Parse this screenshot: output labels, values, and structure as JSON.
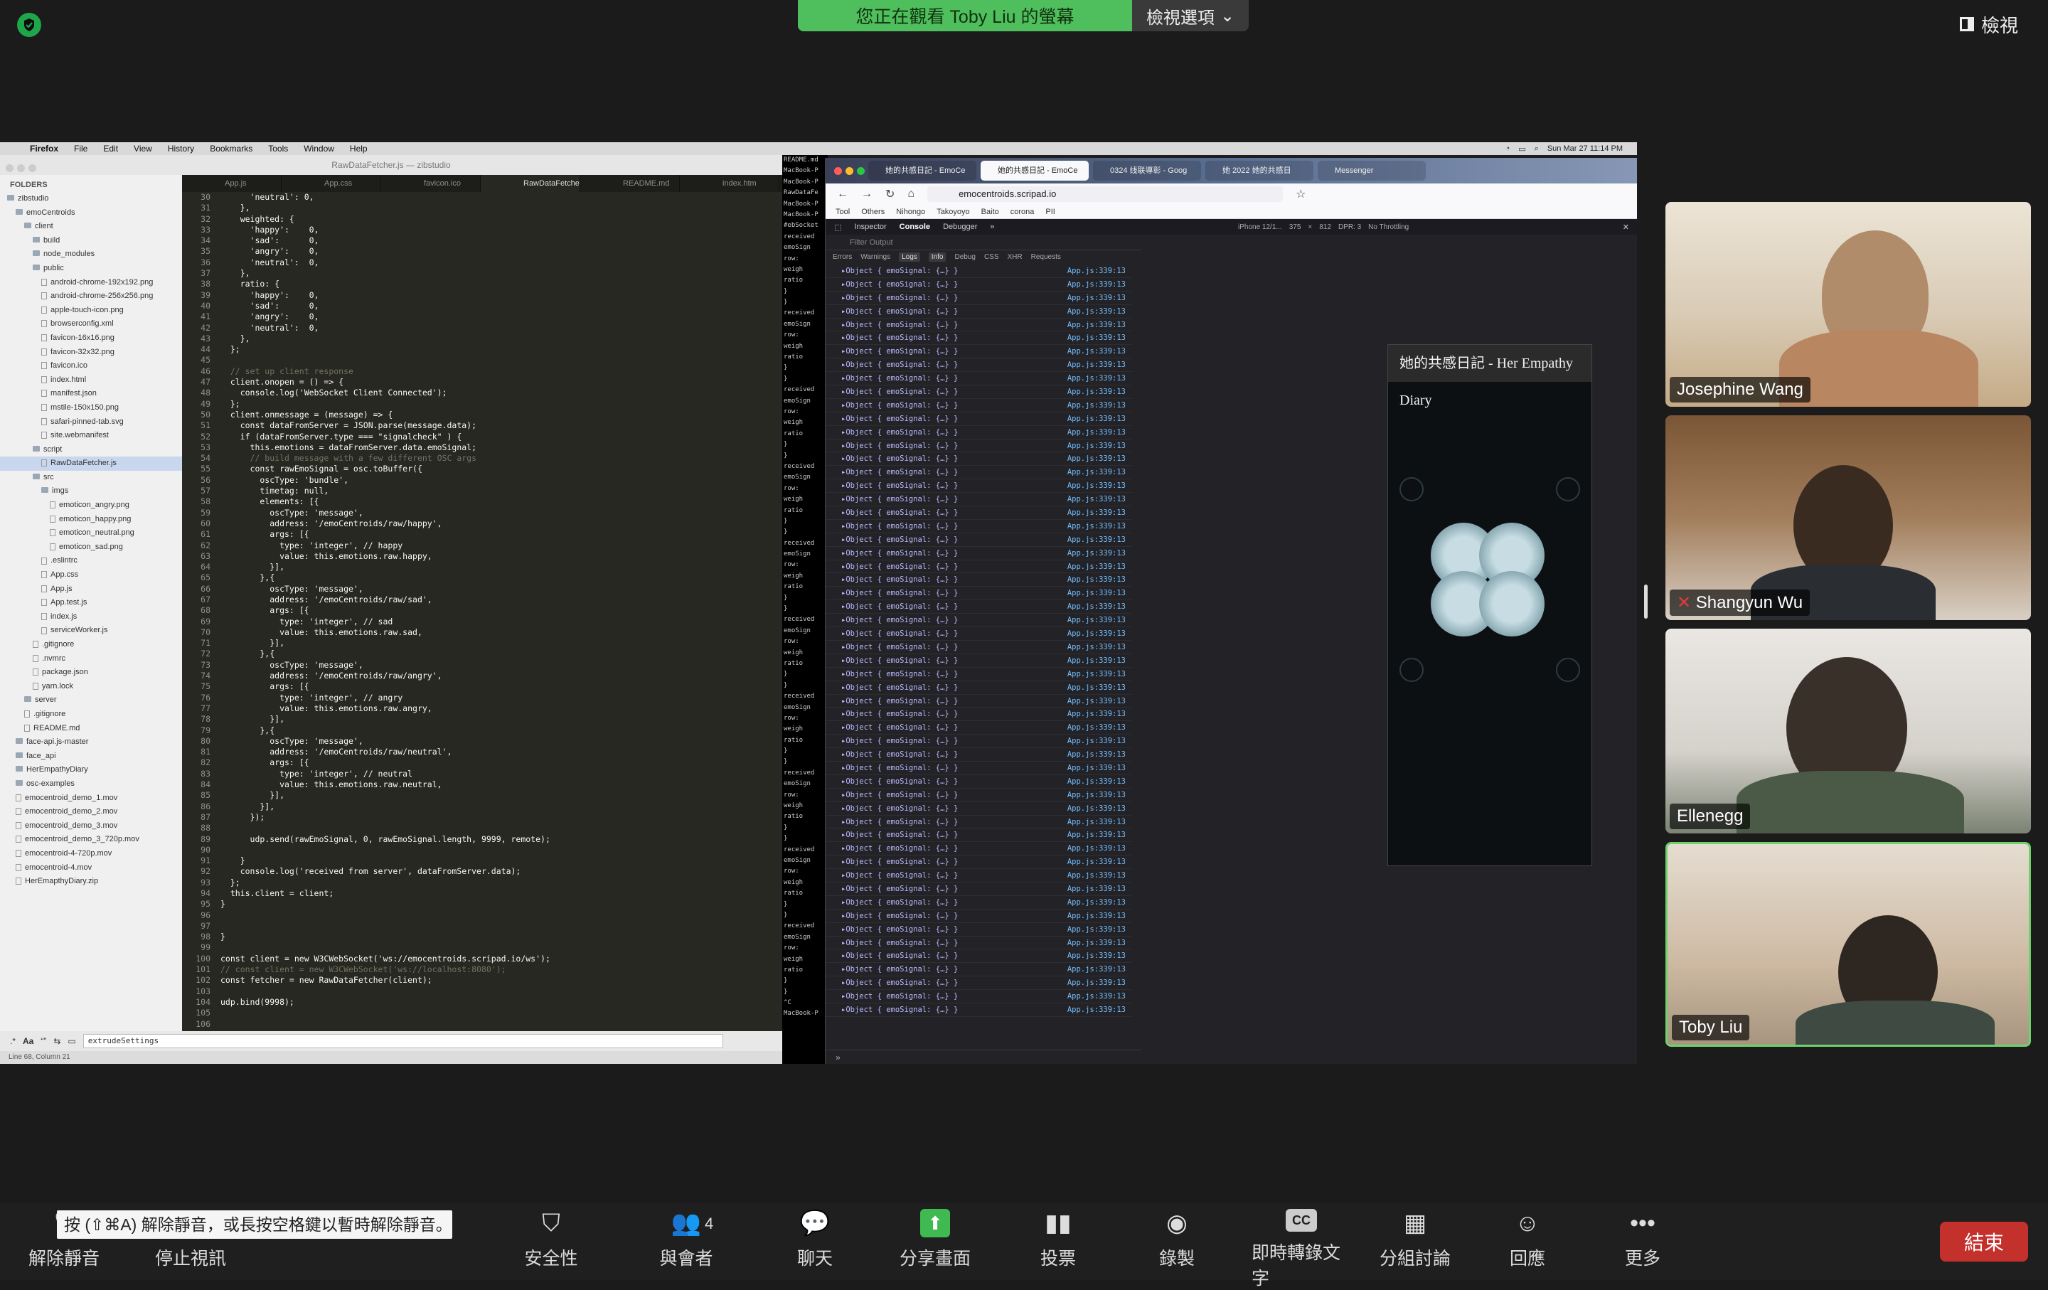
{
  "topbar": {
    "banner": "您正在觀看 Toby Liu 的螢幕",
    "view_options": "檢視選項",
    "view": "檢視"
  },
  "mac_menu": {
    "items": [
      "Firefox",
      "File",
      "Edit",
      "View",
      "History",
      "Bookmarks",
      "Tools",
      "Window",
      "Help"
    ],
    "clock": "Sun Mar 27  11:14 PM"
  },
  "sublime": {
    "title": "RawDataFetcher.js — zibstudio",
    "folders_label": "FOLDERS",
    "tree": [
      {
        "label": "zibstudio",
        "indent": 0,
        "type": "folder"
      },
      {
        "label": "emoCentroids",
        "indent": 1,
        "type": "folder"
      },
      {
        "label": "client",
        "indent": 2,
        "type": "folder"
      },
      {
        "label": "build",
        "indent": 3,
        "type": "folder"
      },
      {
        "label": "node_modules",
        "indent": 3,
        "type": "folder"
      },
      {
        "label": "public",
        "indent": 3,
        "type": "folder"
      },
      {
        "label": "android-chrome-192x192.png",
        "indent": 4,
        "type": "file"
      },
      {
        "label": "android-chrome-256x256.png",
        "indent": 4,
        "type": "file"
      },
      {
        "label": "apple-touch-icon.png",
        "indent": 4,
        "type": "file"
      },
      {
        "label": "browserconfig.xml",
        "indent": 4,
        "type": "file"
      },
      {
        "label": "favicon-16x16.png",
        "indent": 4,
        "type": "file"
      },
      {
        "label": "favicon-32x32.png",
        "indent": 4,
        "type": "file"
      },
      {
        "label": "favicon.ico",
        "indent": 4,
        "type": "file"
      },
      {
        "label": "index.html",
        "indent": 4,
        "type": "file"
      },
      {
        "label": "manifest.json",
        "indent": 4,
        "type": "file"
      },
      {
        "label": "mstile-150x150.png",
        "indent": 4,
        "type": "file"
      },
      {
        "label": "safari-pinned-tab.svg",
        "indent": 4,
        "type": "file"
      },
      {
        "label": "site.webmanifest",
        "indent": 4,
        "type": "file"
      },
      {
        "label": "script",
        "indent": 3,
        "type": "folder"
      },
      {
        "label": "RawDataFetcher.js",
        "indent": 4,
        "type": "file",
        "selected": true
      },
      {
        "label": "src",
        "indent": 3,
        "type": "folder"
      },
      {
        "label": "imgs",
        "indent": 4,
        "type": "folder"
      },
      {
        "label": "emoticon_angry.png",
        "indent": 5,
        "type": "file"
      },
      {
        "label": "emoticon_happy.png",
        "indent": 5,
        "type": "file"
      },
      {
        "label": "emoticon_neutral.png",
        "indent": 5,
        "type": "file"
      },
      {
        "label": "emoticon_sad.png",
        "indent": 5,
        "type": "file"
      },
      {
        "label": ".eslintrc",
        "indent": 4,
        "type": "file"
      },
      {
        "label": "App.css",
        "indent": 4,
        "type": "file"
      },
      {
        "label": "App.js",
        "indent": 4,
        "type": "file"
      },
      {
        "label": "App.test.js",
        "indent": 4,
        "type": "file"
      },
      {
        "label": "index.js",
        "indent": 4,
        "type": "file"
      },
      {
        "label": "serviceWorker.js",
        "indent": 4,
        "type": "file"
      },
      {
        "label": ".gitignore",
        "indent": 3,
        "type": "file"
      },
      {
        "label": ".nvmrc",
        "indent": 3,
        "type": "file"
      },
      {
        "label": "package.json",
        "indent": 3,
        "type": "file"
      },
      {
        "label": "yarn.lock",
        "indent": 3,
        "type": "file"
      },
      {
        "label": "server",
        "indent": 2,
        "type": "folder"
      },
      {
        "label": ".gitignore",
        "indent": 2,
        "type": "file"
      },
      {
        "label": "README.md",
        "indent": 2,
        "type": "file"
      },
      {
        "label": "face-api.js-master",
        "indent": 1,
        "type": "folder"
      },
      {
        "label": "face_api",
        "indent": 1,
        "type": "folder"
      },
      {
        "label": "HerEmpathyDiary",
        "indent": 1,
        "type": "folder"
      },
      {
        "label": "osc-examples",
        "indent": 1,
        "type": "folder"
      },
      {
        "label": "emocentroid_demo_1.mov",
        "indent": 1,
        "type": "file"
      },
      {
        "label": "emocentroid_demo_2.mov",
        "indent": 1,
        "type": "file"
      },
      {
        "label": "emocentroid_demo_3.mov",
        "indent": 1,
        "type": "file"
      },
      {
        "label": "emocentroid_demo_3_720p.mov",
        "indent": 1,
        "type": "file"
      },
      {
        "label": "emocentroid-4-720p.mov",
        "indent": 1,
        "type": "file"
      },
      {
        "label": "emocentroid-4.mov",
        "indent": 1,
        "type": "file"
      },
      {
        "label": "HerEmapthyDiary.zip",
        "indent": 1,
        "type": "file"
      }
    ],
    "tabs": [
      "App.js",
      "App.css",
      "favicon.ico",
      "RawDataFetcher.js",
      "README.md",
      "index.htm"
    ],
    "active_tab": 3,
    "first_line_number": 30,
    "code_lines": [
      "      'neutral': 0,",
      "    },",
      "    weighted: {",
      "      'happy':    0,",
      "      'sad':      0,",
      "      'angry':    0,",
      "      'neutral':  0,",
      "    },",
      "    ratio: {",
      "      'happy':    0,",
      "      'sad':      0,",
      "      'angry':    0,",
      "      'neutral':  0,",
      "    },",
      "  };",
      "",
      "  // set up client response",
      "  client.onopen = () => {",
      "    console.log('WebSocket Client Connected');",
      "  };",
      "  client.onmessage = (message) => {",
      "    const dataFromServer = JSON.parse(message.data);",
      "    if (dataFromServer.type === \"signalcheck\" ) {",
      "      this.emotions = dataFromServer.data.emoSignal;",
      "      // build message with a few different OSC args",
      "      const rawEmoSignal = osc.toBuffer({",
      "        oscType: 'bundle',",
      "        timetag: null,",
      "        elements: [{",
      "          oscType: 'message',",
      "          address: '/emoCentroids/raw/happy',",
      "          args: [{",
      "            type: 'integer', // happy",
      "            value: this.emotions.raw.happy,",
      "          }],",
      "        },{",
      "          oscType: 'message',",
      "          address: '/emoCentroids/raw/sad',",
      "          args: [{",
      "            type: 'integer', // sad",
      "            value: this.emotions.raw.sad,",
      "          }],",
      "        },{",
      "          oscType: 'message',",
      "          address: '/emoCentroids/raw/angry',",
      "          args: [{",
      "            type: 'integer', // angry",
      "            value: this.emotions.raw.angry,",
      "          }],",
      "        },{",
      "          oscType: 'message',",
      "          address: '/emoCentroids/raw/neutral',",
      "          args: [{",
      "            type: 'integer', // neutral",
      "            value: this.emotions.raw.neutral,",
      "          }],",
      "        }],",
      "      });",
      "",
      "      udp.send(rawEmoSignal, 0, rawEmoSignal.length, 9999, remote);",
      "",
      "    }",
      "    console.log('received from server', dataFromServer.data);",
      "  };",
      "  this.client = client;",
      "}",
      "",
      "",
      "}",
      "",
      "const client = new W3CWebSocket('ws://emocentroids.scripad.io/ws');",
      "// const client = new W3CWebSocket('ws://localhost:8080');",
      "const fetcher = new RawDataFetcher(client);",
      "",
      "udp.bind(9998);",
      "",
      ""
    ],
    "find_text": "extrudeSettings",
    "status": "Line 68, Column 21"
  },
  "terminal": {
    "lines": [
      "README.md",
      "MacBook-P",
      "MacBook-P",
      "RawDataFe",
      "MacBook-P",
      "MacBook-P",
      "#ebSocket",
      "received",
      " emoSign",
      "  row:",
      "  weigh",
      "  ratio",
      " }",
      "}",
      "received",
      " emoSign",
      "  row:",
      "  weigh",
      "  ratio",
      " }",
      "}",
      "received",
      " emoSign",
      "  row:",
      "  weigh",
      "  ratio",
      " }",
      "}",
      "received",
      " emoSign",
      "  row:",
      "  weigh",
      "  ratio",
      " }",
      "}",
      "received",
      " emoSign",
      "  row:",
      "  weigh",
      "  ratio",
      " }",
      "}",
      "received",
      " emoSign",
      "  row:",
      "  weigh",
      "  ratio",
      " }",
      "}",
      "received",
      " emoSign",
      "  row:",
      "  weigh",
      "  ratio",
      " }",
      "}",
      "received",
      " emoSign",
      "  row:",
      "  weigh",
      "  ratio",
      " }",
      "}",
      "received",
      " emoSign",
      "  row:",
      "  weigh",
      "  ratio",
      " }",
      "}",
      "received",
      " emoSign",
      "  row:",
      "  weigh",
      "  ratio",
      " }",
      "}",
      "^C",
      "MacBook-P"
    ]
  },
  "firefox": {
    "tabs": [
      "她的共感日記 - EmoCe",
      "她的共感日記 - EmoCe",
      "0324 线联導彰 - Goog",
      "她 2022 她的共感日",
      "Messenger"
    ],
    "active_tab": 1,
    "url": "emocentroids.scripad.io",
    "bookmarks": [
      "Tool",
      "Others",
      "Nihongo",
      "Takoyoyo",
      "Baito",
      "corona",
      "PII"
    ],
    "devtools": {
      "tabs": [
        "Inspector",
        "Console",
        "Debugger"
      ],
      "active": "Console",
      "device": "iPhone 12/1...",
      "width": "375",
      "height": "812",
      "dpr": "DPR: 3",
      "throttle": "No Throttling",
      "filter_placeholder": "Filter Output",
      "console_tabs": [
        "Errors",
        "Warnings",
        "Logs",
        "Info",
        "Debug",
        "CSS",
        "XHR",
        "Requests"
      ],
      "log_entry": "Object { emoSignal: {…} }",
      "log_source": "App.js:339:13",
      "log_count": 56
    },
    "app": {
      "title": "她的共感日記 - Her Empathy Diary"
    }
  },
  "participants": [
    {
      "name": "Josephine Wang",
      "muted": false
    },
    {
      "name": "Shangyun Wu",
      "muted": true
    },
    {
      "name": "Ellenegg",
      "muted": false
    },
    {
      "name": "Toby Liu",
      "muted": false,
      "active_speaker": true
    }
  ],
  "bottom": {
    "tooltip": "按 (⇧⌘A) 解除靜音，或長按空格鍵以暫時解除靜音。",
    "controls": [
      {
        "label": "解除靜音",
        "icon": "microphone-muted-icon"
      },
      {
        "label": "停止視訊",
        "icon": "video-camera-icon"
      },
      {
        "label": "安全性",
        "icon": "shield-icon"
      },
      {
        "label": "與會者",
        "icon": "participants-icon",
        "count": "4"
      },
      {
        "label": "聊天",
        "icon": "chat-bubble-icon"
      },
      {
        "label": "分享畫面",
        "icon": "share-screen-icon"
      },
      {
        "label": "投票",
        "icon": "poll-bars-icon"
      },
      {
        "label": "錄製",
        "icon": "record-icon"
      },
      {
        "label": "即時轉錄文字",
        "icon": "closed-caption-icon",
        "badge": "CC"
      },
      {
        "label": "分組討論",
        "icon": "breakout-rooms-icon"
      },
      {
        "label": "回應",
        "icon": "reaction-emoji-icon"
      },
      {
        "label": "更多",
        "icon": "more-dots-icon"
      }
    ],
    "end_label": "結束"
  },
  "colors": {
    "zoom_green": "#4fbf5d",
    "end_red": "#c4302b",
    "active_speaker_border": "#6fd16b"
  }
}
